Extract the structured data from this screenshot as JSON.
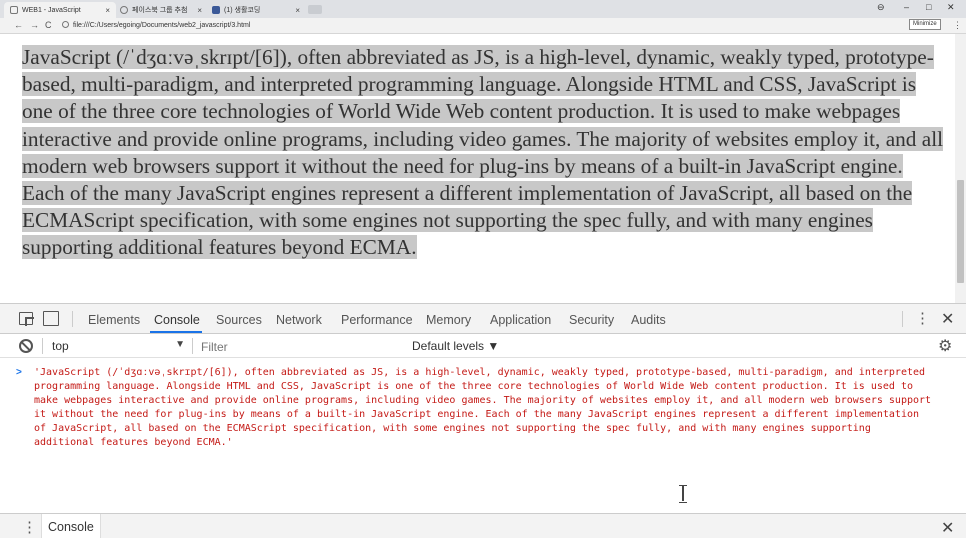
{
  "browser": {
    "tabs": [
      {
        "title": "WEB1 - JavaScript",
        "active": true
      },
      {
        "title": "페이스북 그룹 추첨",
        "active": false
      },
      {
        "title": "(1) 생활코딩",
        "active": false
      }
    ],
    "window_controls": {
      "account": "⊖",
      "minimize": "–",
      "maximize": "□",
      "close": "✕"
    },
    "nav": {
      "back": "←",
      "forward": "→",
      "reload": "C"
    },
    "url": "file:///C:/Users/egoing/Documents/web2_javascript/3.html",
    "tooltip": "Minimize",
    "menu": "⋮"
  },
  "page": {
    "paragraph": "JavaScript (/ˈdʒɑːvəˌskrɪpt/[6]), often abbreviated as JS, is a high-level, dynamic, weakly typed, prototype-based, multi-paradigm, and interpreted programming language. Alongside HTML and CSS, JavaScript is one of the three core technologies of World Wide Web content production. It is used to make webpages interactive and provide online programs, including video games. The majority of websites employ it, and all modern web browsers support it without the need for plug-ins by means of a built-in JavaScript engine. Each of the many JavaScript engines represent a different implementation of JavaScript, all based on the ECMAScript specification, with some engines not supporting the spec fully, and with many engines supporting additional features beyond ECMA."
  },
  "devtools": {
    "tabs": [
      "Elements",
      "Console",
      "Sources",
      "Network",
      "Performance",
      "Memory",
      "Application",
      "Security",
      "Audits"
    ],
    "active_tab": "Console",
    "more": "⋮",
    "close": "✕",
    "toolbar": {
      "context": "top",
      "context_arrow": "▼",
      "filter_placeholder": "Filter",
      "levels": "Default levels ▼",
      "settings": "⚙"
    },
    "console": {
      "prompt": ">",
      "input": "'JavaScript (/ˈdʒɑːvəˌskrɪpt/[6]), often abbreviated as JS, is a high-level, dynamic, weakly typed, prototype-based, multi-paradigm, and interpreted programming language. Alongside HTML and CSS, JavaScript is one of the three core technologies of World Wide Web content production. It is used to make webpages interactive and provide online programs, including video games. The majority of websites employ it, and all modern web browsers support it without the need for plug-ins by means of a built-in JavaScript engine. Each of the many JavaScript engines represent a different implementation of JavaScript, all based on the ECMAScript specification, with some engines not supporting the spec fully, and with many engines supporting additional features beyond ECMA.'"
    },
    "drawer": {
      "menu": "⋮",
      "tab": "Console",
      "close": "✕"
    }
  },
  "colors": {
    "accent": "#1a73e8",
    "string_red": "#c41a16",
    "selection": "#c8c8c8"
  }
}
